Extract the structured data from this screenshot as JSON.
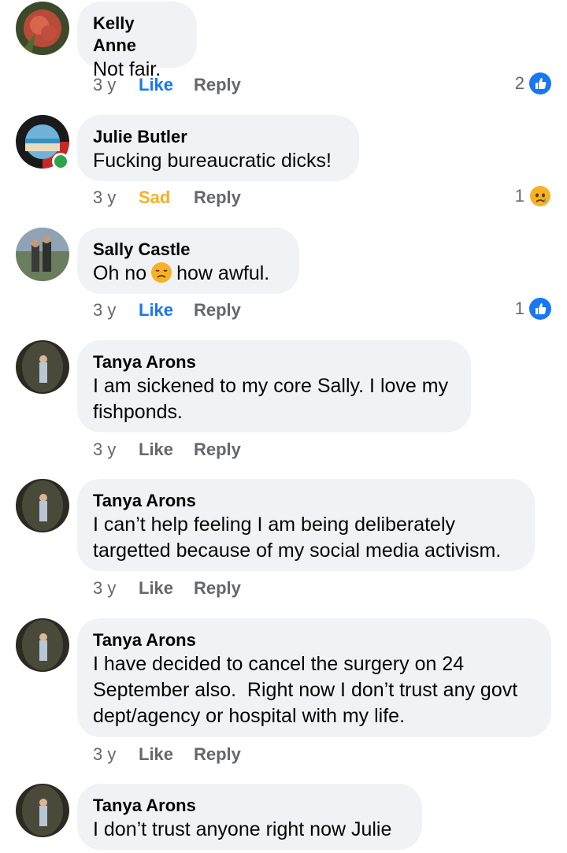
{
  "comments": [
    {
      "author": "Kelly Anne",
      "text": "Not fair.",
      "time": "3 y",
      "action": "Like",
      "reply": "Reply",
      "reaction_count": "2",
      "reaction_type": "like-icon"
    },
    {
      "author": "Julie Butler",
      "text": "Fucking bureaucratic dicks!",
      "time": "3 y",
      "action": "Sad",
      "reply": "Reply",
      "reaction_count": "1",
      "reaction_type": "sad-icon"
    },
    {
      "author": "Sally Castle",
      "text_before": "Oh no",
      "text_after": "how awful.",
      "time": "3 y",
      "action": "Like",
      "reply": "Reply",
      "reaction_count": "1",
      "reaction_type": "like-icon"
    },
    {
      "author": "Tanya Arons",
      "line1": "I am sickened to my core Sally. I love my",
      "line2": "fishponds.",
      "time": "3 y",
      "action": "Like",
      "reply": "Reply"
    },
    {
      "author": "Tanya Arons",
      "line1": "I can’t help feeling I am being deliberately",
      "line2": "targetted because of my social media activism.",
      "time": "3 y",
      "action": "Like",
      "reply": "Reply"
    },
    {
      "author": "Tanya Arons",
      "line1": "I have decided to cancel the surgery on 24",
      "line2": "September also.  Right now I don’t trust any govt",
      "line3": "dept/agency or hospital with my life.",
      "time": "3 y",
      "action": "Like",
      "reply": "Reply"
    },
    {
      "author": "Tanya Arons",
      "text": "I don’t trust anyone right now Julie"
    }
  ],
  "colors": {
    "bubble": "#f0f2f5",
    "like_blue": "#1877f2",
    "sad_yellow": "#f7b125",
    "meta_gray": "#65676b",
    "online_green": "#31a24c"
  }
}
